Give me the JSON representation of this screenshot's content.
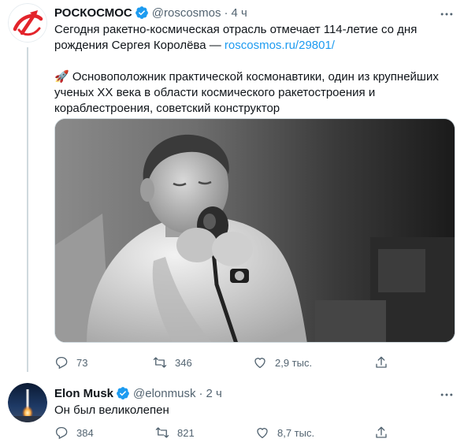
{
  "tweets": [
    {
      "author_name": "РОСКОСМОС",
      "handle": "@roscosmos",
      "separator": "·",
      "time": "4 ч",
      "text_line1": "Сегодня ракетно-космическая отрасль отмечает 114-летие со дня",
      "text_line2_prefix": "рождения Сергея Королёва — ",
      "link": "roscosmos.ru/29801/",
      "emoji": "🚀",
      "text_para2_line1": " Основоположник практической космонавтики, один из крупнейших",
      "text_para2_line2": "ученых XX века в области космического ракетостроения и",
      "text_para2_line3": "кораблестроения, советский конструктор",
      "replies": "73",
      "retweets": "346",
      "likes": "2,9 тыс."
    },
    {
      "author_name": "Elon Musk",
      "handle": "@elonmusk",
      "separator": "·",
      "time": "2 ч",
      "text": "Он был великолепен",
      "replies": "384",
      "retweets": "821",
      "likes": "8,7 тыс."
    }
  ],
  "icons": {
    "verified": "verified-badge-icon",
    "more": "more-icon",
    "reply": "reply-icon",
    "retweet": "retweet-icon",
    "like": "heart-icon",
    "share": "share-icon"
  },
  "colors": {
    "verified": "#1d9bf0",
    "link": "#1d9bf0",
    "secondary_text": "#536471",
    "thread_line": "#cfd9de",
    "roscosmos_red": "#e3242b"
  }
}
